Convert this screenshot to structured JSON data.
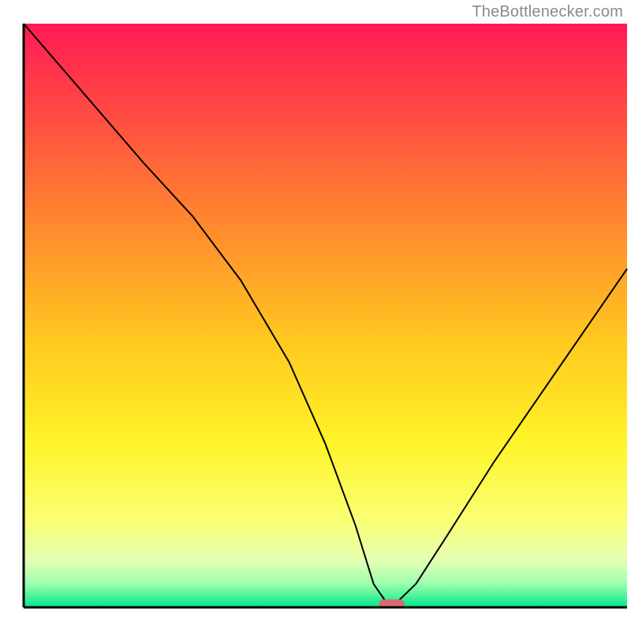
{
  "attribution": {
    "text": "TheBottlenecker.com"
  },
  "chart_data": {
    "type": "line",
    "title": "",
    "xlabel": "",
    "ylabel": "",
    "xlim": [
      0,
      100
    ],
    "ylim": [
      0,
      100
    ],
    "axes_visible": {
      "left": true,
      "bottom": true,
      "right": false,
      "top": false
    },
    "grid": false,
    "legend": false,
    "background": {
      "type": "vertical-gradient",
      "stops": [
        {
          "pct": 0,
          "color": "#ff1a55"
        },
        {
          "pct": 15,
          "color": "#ff4943"
        },
        {
          "pct": 35,
          "color": "#ff8b2e"
        },
        {
          "pct": 55,
          "color": "#ffca1f"
        },
        {
          "pct": 72,
          "color": "#fff429"
        },
        {
          "pct": 85,
          "color": "#faff74"
        },
        {
          "pct": 92,
          "color": "#e4ffb2"
        },
        {
          "pct": 96,
          "color": "#9bffad"
        },
        {
          "pct": 100,
          "color": "#00e88a"
        }
      ]
    },
    "series": [
      {
        "name": "bottleneck-curve",
        "color": "#000000",
        "stroke_width": 2,
        "x": [
          0,
          10,
          20,
          28,
          36,
          44,
          50,
          55,
          58,
          60,
          62,
          65,
          70,
          78,
          88,
          100
        ],
        "values": [
          100,
          88,
          76,
          67,
          56,
          42,
          28,
          14,
          4,
          1,
          1,
          4,
          12,
          25,
          40,
          58
        ]
      }
    ],
    "marker": {
      "name": "optimal-point",
      "x": 61,
      "y": 0.6,
      "color": "#d86a6e",
      "width": 4.2,
      "height": 1.5,
      "rx": 0.75
    }
  }
}
